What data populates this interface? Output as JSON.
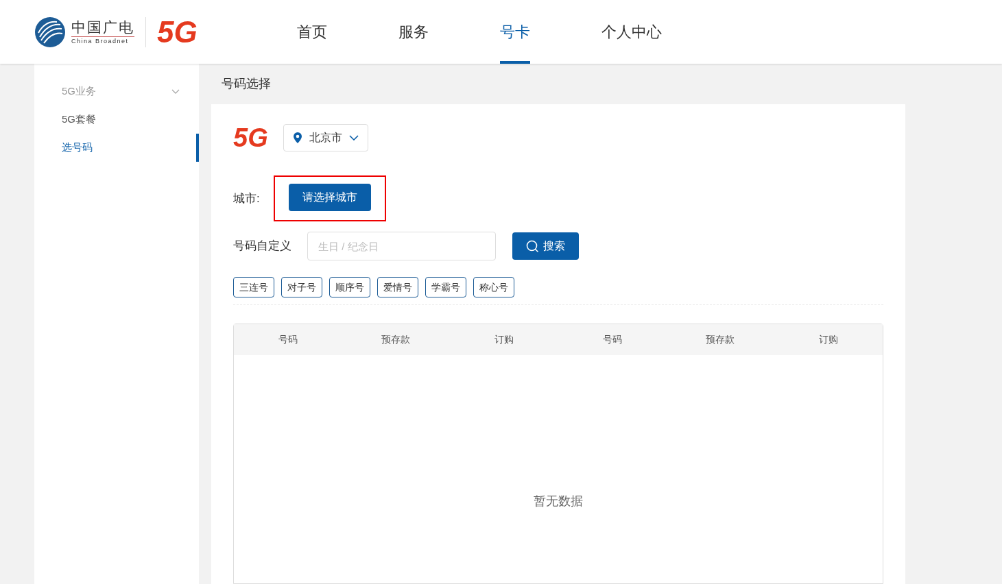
{
  "header": {
    "logo": {
      "cn": "中国广电",
      "en": "China Broadnet",
      "fiveg": "5G"
    },
    "nav": [
      {
        "label": "首页",
        "selected": false
      },
      {
        "label": "服务",
        "selected": false
      },
      {
        "label": "号卡",
        "selected": true
      },
      {
        "label": "个人中心",
        "selected": false
      }
    ]
  },
  "sidebar": {
    "items": [
      {
        "label": "5G业务",
        "selected": false,
        "expandable": true
      },
      {
        "label": "5G套餐",
        "selected": false,
        "expandable": false
      },
      {
        "label": "选号码",
        "selected": true,
        "expandable": false
      }
    ]
  },
  "page_title": "号码选择",
  "card": {
    "logo": "5G",
    "province": "北京市",
    "city_label": "城市:",
    "city_button": "请选择城市",
    "city_highlighted": true,
    "custom_label": "号码自定义",
    "custom_placeholder": "生日 / 纪念日",
    "search_button": "搜索",
    "tags": [
      "三连号",
      "对子号",
      "顺序号",
      "爱情号",
      "学霸号",
      "称心号"
    ],
    "table": {
      "columns": [
        "号码",
        "预存款",
        "订购",
        "号码",
        "预存款",
        "订购"
      ],
      "empty_text": "暂无数据"
    }
  }
}
